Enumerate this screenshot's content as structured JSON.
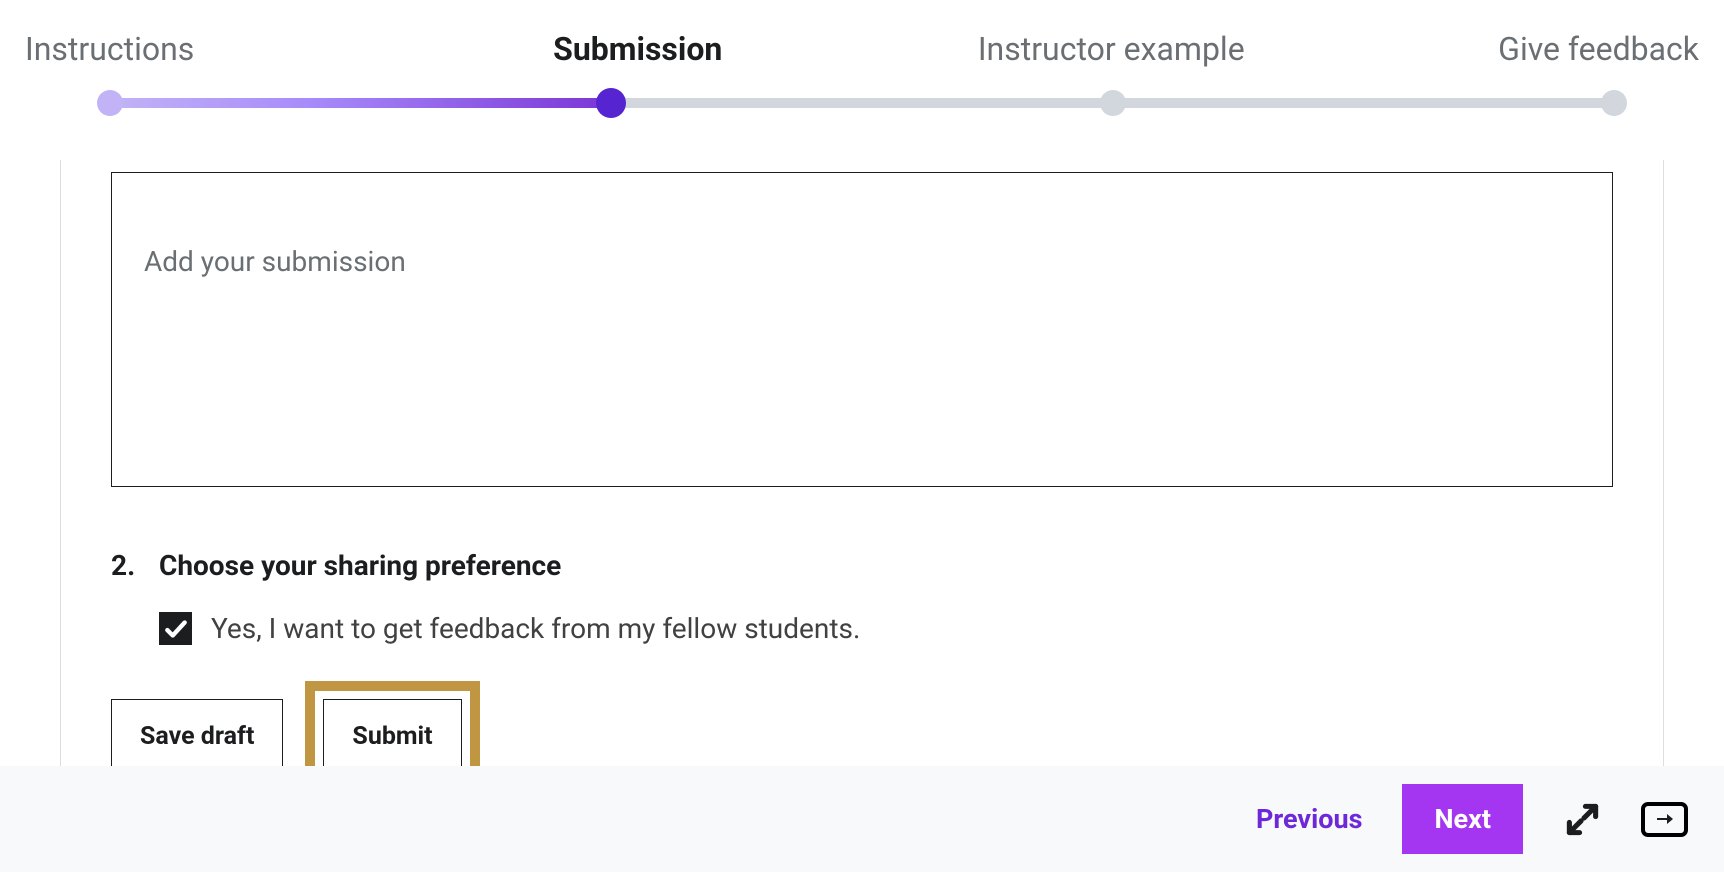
{
  "stepper": {
    "steps": [
      {
        "label": "Instructions",
        "active": false
      },
      {
        "label": "Submission",
        "active": true
      },
      {
        "label": "Instructor example",
        "active": false
      },
      {
        "label": "Give feedback",
        "active": false
      }
    ]
  },
  "editor": {
    "placeholder": "Add your submission"
  },
  "section2": {
    "number": "2.",
    "title": "Choose your sharing preference"
  },
  "share_checkbox": {
    "checked": true,
    "label": "Yes, I want to get feedback from my fellow students."
  },
  "buttons": {
    "save_draft": "Save draft",
    "submit": "Submit"
  },
  "footer": {
    "previous": "Previous",
    "next": "Next"
  }
}
